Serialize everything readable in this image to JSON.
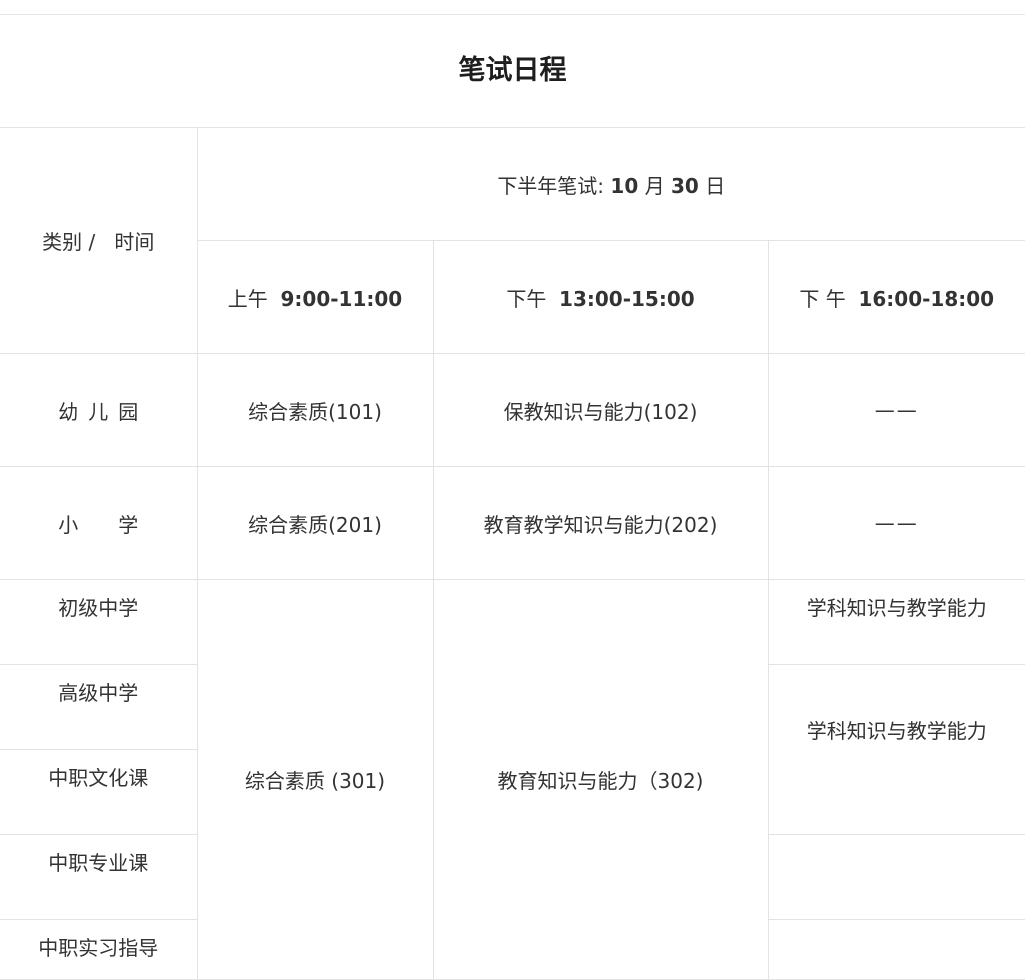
{
  "title": "笔试日程",
  "header": {
    "category_time": "类别 /   时间",
    "exam_date_prefix": "下半年笔试:",
    "exam_month": "10",
    "exam_month_unit": "月",
    "exam_day": "30",
    "exam_day_unit": "日",
    "slots": [
      {
        "period": "上午",
        "time": "9:00-11:00"
      },
      {
        "period": "下午",
        "time": "13:00-15:00"
      },
      {
        "period": "下 午",
        "time": "16:00-18:00"
      }
    ]
  },
  "rows": {
    "kindergarten": {
      "category": "幼儿园",
      "s1": "综合素质(101)",
      "s2": "保教知识与能力(102)",
      "s3": "——"
    },
    "primary": {
      "category": "小　学",
      "s1": "综合素质(201)",
      "s2": "教育教学知识与能力(202)",
      "s3": "——"
    },
    "junior": {
      "category": "初级中学",
      "s3": "学科知识与教学能力"
    },
    "senior": {
      "category": "高级中学",
      "s3": "学科知识与教学能力"
    },
    "vocational_culture": {
      "category": "中职文化课"
    },
    "vocational_major": {
      "category": "中职专业课"
    },
    "vocational_intern": {
      "category": "中职实习指导"
    },
    "secondary_shared": {
      "s1": "综合素质 (301)",
      "s2": "教育知识与能力（302)"
    }
  }
}
